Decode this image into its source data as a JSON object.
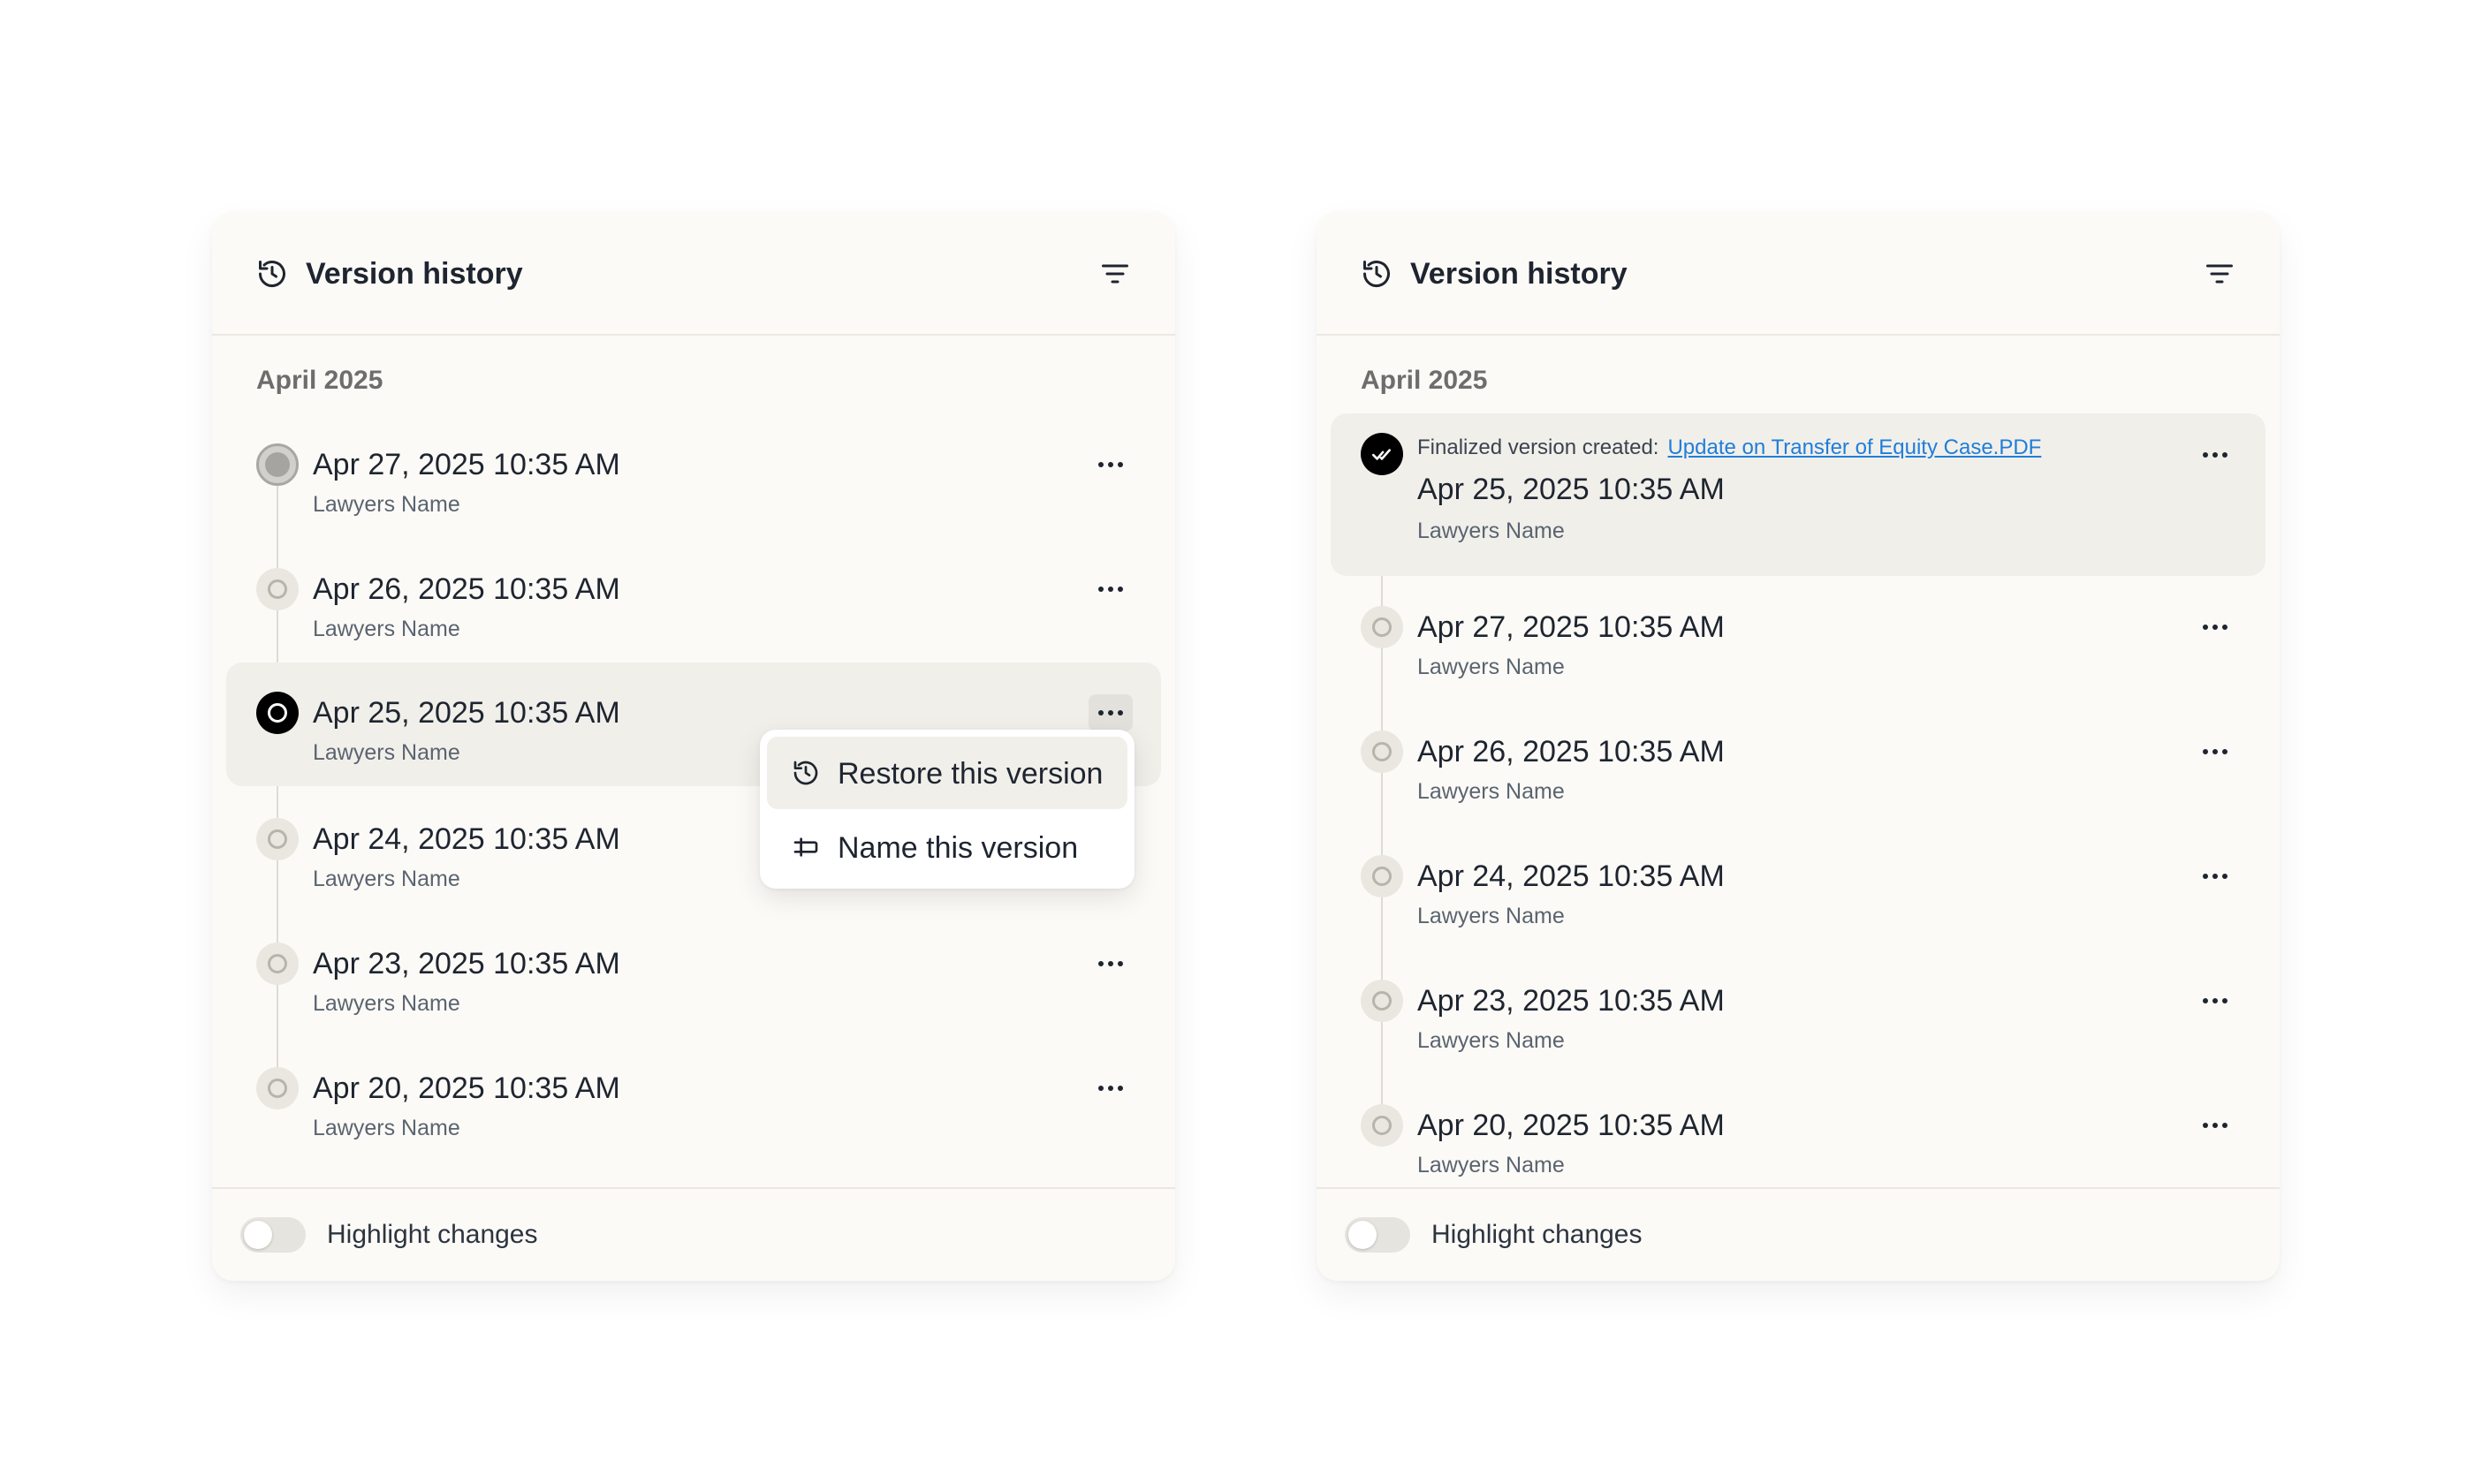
{
  "left_panel": {
    "title": "Version history",
    "month": "April 2025",
    "versions": [
      {
        "date": "Apr 27, 2025 10:35 AM",
        "author": "Lawyers Name"
      },
      {
        "date": "Apr 26, 2025 10:35 AM",
        "author": "Lawyers Name"
      },
      {
        "date": "Apr 25, 2025 10:35 AM",
        "author": "Lawyers Name"
      },
      {
        "date": "Apr 24, 2025 10:35 AM",
        "author": "Lawyers Name"
      },
      {
        "date": "Apr 23, 2025 10:35 AM",
        "author": "Lawyers Name"
      },
      {
        "date": "Apr 20, 2025 10:35 AM",
        "author": "Lawyers Name"
      }
    ],
    "menu": {
      "restore_label": "Restore this version",
      "name_label": "Name this version"
    },
    "footer": {
      "toggle_label": "Highlight changes",
      "toggle_on": false
    }
  },
  "right_panel": {
    "title": "Version history",
    "month": "April 2025",
    "finalized": {
      "note": "Finalized version created:",
      "link": "Update on Transfer of Equity Case.PDF",
      "date": "Apr 25, 2025 10:35 AM",
      "author": "Lawyers Name"
    },
    "versions": [
      {
        "date": "Apr 27, 2025 10:35 AM",
        "author": "Lawyers Name"
      },
      {
        "date": "Apr 26, 2025 10:35 AM",
        "author": "Lawyers Name"
      },
      {
        "date": "Apr 24, 2025 10:35 AM",
        "author": "Lawyers Name"
      },
      {
        "date": "Apr 23, 2025 10:35 AM",
        "author": "Lawyers Name"
      },
      {
        "date": "Apr 20, 2025 10:35 AM",
        "author": "Lawyers Name"
      }
    ],
    "footer": {
      "toggle_label": "Highlight changes",
      "toggle_on": false
    }
  },
  "colors": {
    "panel_bg": "#fcfaf6",
    "selected_row_bg": "#f1efea",
    "link": "#1f7ed9",
    "text": "#1e2530"
  }
}
